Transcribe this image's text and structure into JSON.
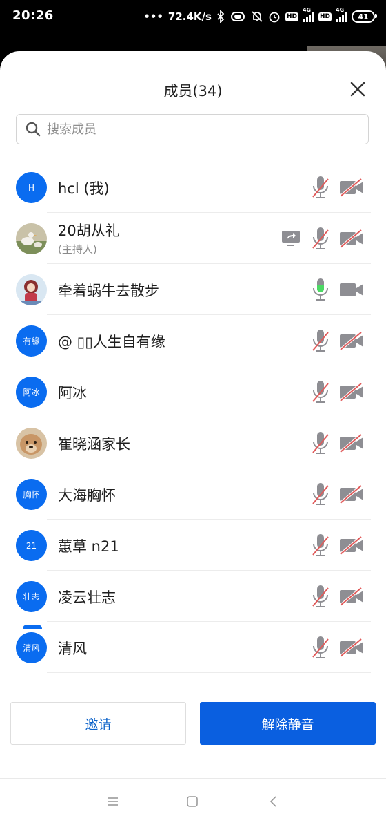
{
  "status_bar": {
    "time": "20:26",
    "network_speed": "72.4K/s",
    "sim1_label": "HD",
    "sim1_network": "4G",
    "sim2_label": "HD",
    "sim2_network": "4G",
    "battery": "41"
  },
  "header": {
    "title": "成员(34)"
  },
  "search": {
    "placeholder": "搜索成员",
    "value": ""
  },
  "members": [
    {
      "name": "hcl (我)",
      "subtitle": "",
      "avatar_text": "H",
      "avatar_type": "initial",
      "sharing": false,
      "mic_on": false,
      "camera_on": false
    },
    {
      "name": "20胡从礼",
      "subtitle": "(主持人)",
      "avatar_text": "",
      "avatar_type": "photo-goose",
      "sharing": true,
      "mic_on": false,
      "camera_on": false
    },
    {
      "name": "牵着蜗牛去散步",
      "subtitle": "",
      "avatar_text": "",
      "avatar_type": "photo-girl",
      "sharing": false,
      "mic_on": true,
      "camera_on": true
    },
    {
      "name": "@ ▯▯人生自有缘",
      "subtitle": "",
      "avatar_text": "有緣",
      "avatar_type": "initial",
      "sharing": false,
      "mic_on": false,
      "camera_on": false
    },
    {
      "name": "阿冰",
      "subtitle": "",
      "avatar_text": "阿冰",
      "avatar_type": "initial",
      "sharing": false,
      "mic_on": false,
      "camera_on": false
    },
    {
      "name": "崔晓涵家长",
      "subtitle": "",
      "avatar_text": "",
      "avatar_type": "photo-dog",
      "sharing": false,
      "mic_on": false,
      "camera_on": false
    },
    {
      "name": "大海胸怀",
      "subtitle": "",
      "avatar_text": "胸怀",
      "avatar_type": "initial",
      "sharing": false,
      "mic_on": false,
      "camera_on": false
    },
    {
      "name": "蕙草 n21",
      "subtitle": "",
      "avatar_text": "21",
      "avatar_type": "initial",
      "sharing": false,
      "mic_on": false,
      "camera_on": false
    },
    {
      "name": "凌云壮志",
      "subtitle": "",
      "avatar_text": "壮志",
      "avatar_type": "initial",
      "sharing": false,
      "mic_on": false,
      "camera_on": false
    },
    {
      "name": "清风",
      "subtitle": "",
      "avatar_text": "清风",
      "avatar_type": "initial",
      "sharing": false,
      "mic_on": false,
      "camera_on": false
    }
  ],
  "actions": {
    "invite_label": "邀请",
    "unmute_label": "解除静音"
  },
  "colors": {
    "accent": "#0a5fe0",
    "avatar_bg": "#0a6cf0",
    "muted_slash": "#e05a5a",
    "mic_active": "#4cd964",
    "icon_gray": "#8e8e93"
  }
}
